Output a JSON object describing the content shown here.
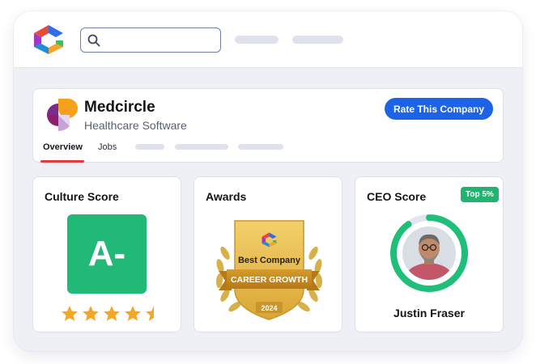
{
  "search": {
    "value": "",
    "placeholder": ""
  },
  "company": {
    "name": "Medcircle",
    "category": "Healthcare Software",
    "rate_button": "Rate This Company",
    "tabs": [
      {
        "label": "Overview",
        "active": true
      },
      {
        "label": "Jobs",
        "active": false
      }
    ]
  },
  "culture": {
    "title": "Culture Score",
    "grade": "A-",
    "stars": 4.5,
    "star_max": 5
  },
  "awards": {
    "title": "Awards",
    "badge_line1": "Best Company",
    "badge_line2": "CAREER GROWTH",
    "badge_year": "2024"
  },
  "ceo": {
    "title": "CEO Score",
    "badge": "Top 5%",
    "name": "Justin Fraser",
    "score_fraction": 0.9
  },
  "icons": {
    "search": "search-icon",
    "app_logo": "comparably-logo",
    "company_logo": "medcircle-logo",
    "star": "star-icon"
  },
  "colors": {
    "primary_button": "#1d63e8",
    "grade_green": "#22b878",
    "star_orange": "#f5a623",
    "tab_underline": "#e03a3a",
    "ring_green": "#1fbf7a",
    "badge_gold": "#e6b93f"
  }
}
